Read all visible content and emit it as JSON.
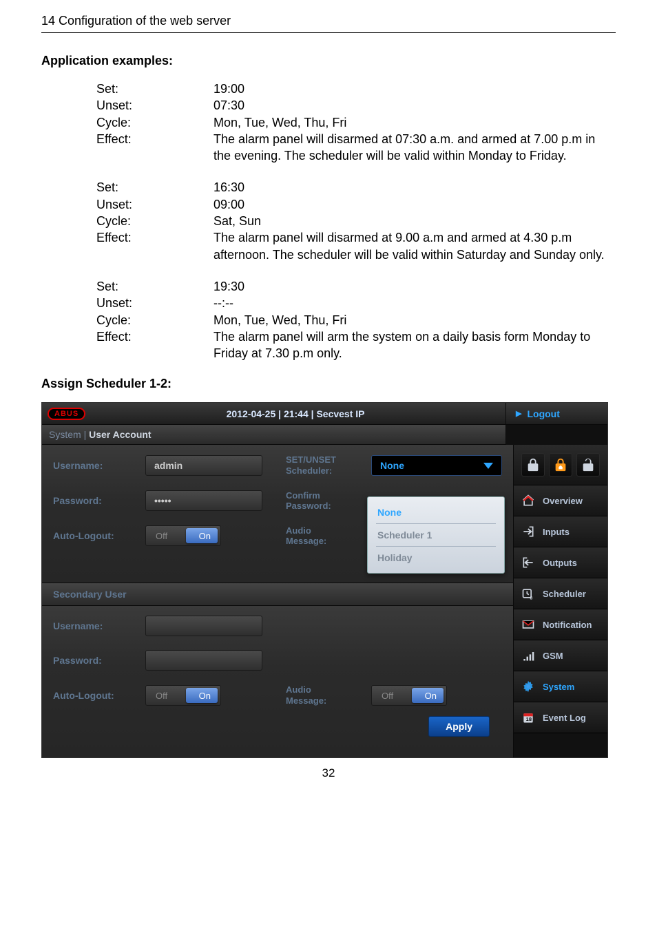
{
  "header": "14  Configuration of the web server",
  "app_examples": {
    "title": "Application examples:",
    "groups": [
      {
        "rows": [
          {
            "label": "Set:",
            "value": "19:00"
          },
          {
            "label": "Unset:",
            "value": "07:30"
          },
          {
            "label": "Cycle:",
            "value": "Mon, Tue, Wed, Thu, Fri"
          },
          {
            "label": "Effect:",
            "value": "The alarm panel will disarmed at 07:30 a.m. and armed at 7.00 p.m in the evening. The scheduler will be valid within Monday to Friday."
          }
        ]
      },
      {
        "rows": [
          {
            "label": "Set:",
            "value": "16:30"
          },
          {
            "label": "Unset:",
            "value": "09:00"
          },
          {
            "label": "Cycle:",
            "value": "Sat, Sun"
          },
          {
            "label": "Effect:",
            "value": "The alarm panel will disarmed at 9.00 a.m and armed at 4.30 p.m afternoon. The scheduler will be valid within Saturday and Sunday only."
          }
        ]
      },
      {
        "rows": [
          {
            "label": "Set:",
            "value": "19:30"
          },
          {
            "label": "Unset:",
            "value": "--:--"
          },
          {
            "label": "Cycle:",
            "value": "Mon, Tue, Wed, Thu, Fri"
          },
          {
            "label": "Effect:",
            "value": "The alarm panel will arm the system on a daily basis form Monday to Friday at 7.30 p.m only."
          }
        ]
      }
    ]
  },
  "assign_title": "Assign Scheduler 1-2:",
  "panel": {
    "logo": "ABUS",
    "datetime": "2012-04-25  |  21:44  |  Secvest IP",
    "logout": "Logout",
    "breadcrumb_prefix": "System | ",
    "breadcrumb_current": "User Account",
    "labels": {
      "username": "Username:",
      "password": "Password:",
      "auto_logout": "Auto-Logout:",
      "set_unset_scheduler": "SET/UNSET Scheduler:",
      "confirm_password": "Confirm Password:",
      "audio_message": "Audio Message:",
      "secondary_user": "Secondary User",
      "apply": "Apply"
    },
    "values": {
      "username": "admin",
      "password": "•••••",
      "scheduler_selected": "None",
      "scheduler_options": [
        "None",
        "Scheduler 1",
        "Holiday"
      ],
      "toggle_off": "Off",
      "toggle_on": "On"
    },
    "sidebar": {
      "overview": "Overview",
      "inputs": "Inputs",
      "outputs": "Outputs",
      "scheduler": "Scheduler",
      "notification": "Notification",
      "gsm": "GSM",
      "system": "System",
      "event_log": "Event Log"
    }
  },
  "page_number": "32"
}
